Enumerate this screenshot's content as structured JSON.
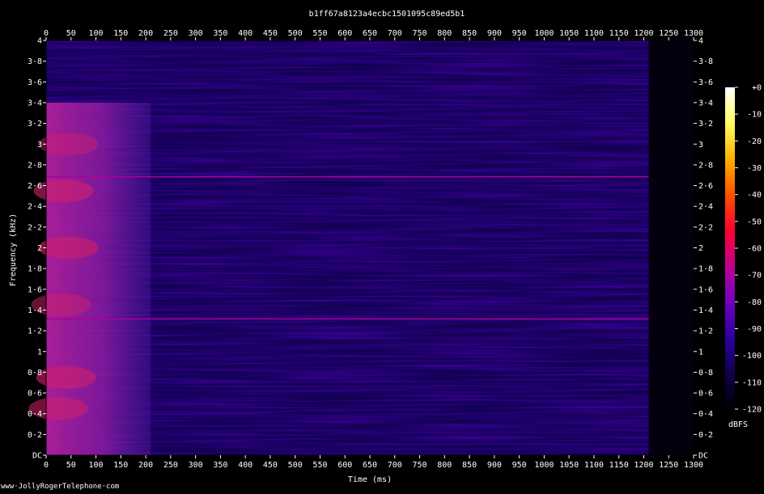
{
  "chart_data": {
    "type": "heatmap",
    "title": "b1ff67a8123a4ecbc1501095c89ed5b1",
    "xlabel": "Time (ms)",
    "ylabel": "Frequency (kHz)",
    "xlim": [
      0,
      1300
    ],
    "ylim": [
      0,
      4
    ],
    "x_ticks": [
      "0",
      "50",
      "100",
      "150",
      "200",
      "250",
      "300",
      "350",
      "400",
      "450",
      "500",
      "550",
      "600",
      "650",
      "700",
      "750",
      "800",
      "850",
      "900",
      "950",
      "1000",
      "1050",
      "1100",
      "1150",
      "1200",
      "1250",
      "1300"
    ],
    "y_ticks": [
      {
        "value": 4,
        "label": "4"
      },
      {
        "value": 3.8,
        "label": "3·8"
      },
      {
        "value": 3.6,
        "label": "3·6"
      },
      {
        "value": 3.4,
        "label": "3·4"
      },
      {
        "value": 3.2,
        "label": "3·2"
      },
      {
        "value": 3,
        "label": "3"
      },
      {
        "value": 2.8,
        "label": "2·8"
      },
      {
        "value": 2.6,
        "label": "2·6"
      },
      {
        "value": 2.4,
        "label": "2·4"
      },
      {
        "value": 2.2,
        "label": "2·2"
      },
      {
        "value": 2,
        "label": "2"
      },
      {
        "value": 1.8,
        "label": "1·8"
      },
      {
        "value": 1.6,
        "label": "1·6"
      },
      {
        "value": 1.4,
        "label": "1·4"
      },
      {
        "value": 1.2,
        "label": "1·2"
      },
      {
        "value": 1,
        "label": "1"
      },
      {
        "value": 0.8,
        "label": "0·8"
      },
      {
        "value": 0.6,
        "label": "0·6"
      },
      {
        "value": 0.4,
        "label": "0·4"
      },
      {
        "value": 0.2,
        "label": "0·2"
      },
      {
        "value": 0,
        "label": "DC"
      }
    ],
    "colorbar": {
      "label": "dBFS",
      "range": [
        -120,
        0
      ],
      "ticks": [
        "+0",
        "-10",
        "-20",
        "-30",
        "-40",
        "-50",
        "-60",
        "-70",
        "-80",
        "-90",
        "-100",
        "-110",
        "-120"
      ],
      "colors": [
        "#000000",
        "#10004a",
        "#2a00a0",
        "#7000c0",
        "#c00090",
        "#ff0030",
        "#ff5000",
        "#ffb000",
        "#ffff60",
        "#ffffff"
      ]
    },
    "regions": [
      {
        "name": "onset burst",
        "t_start": 0,
        "t_end": 210,
        "f_start": 0,
        "f_end": 3.4,
        "level_db": -55
      },
      {
        "name": "background",
        "t_start": 210,
        "t_end": 1210,
        "f_start": 0,
        "f_end": 4,
        "level_db": -105
      },
      {
        "name": "tone line",
        "t_start": 0,
        "t_end": 1210,
        "f_start": 2.68,
        "f_end": 2.69,
        "level_db": -70
      },
      {
        "name": "tone line",
        "t_start": 0,
        "t_end": 1210,
        "f_start": 1.31,
        "f_end": 1.32,
        "level_db": -70
      },
      {
        "name": "silence",
        "t_start": 1210,
        "t_end": 1300,
        "f_start": 0,
        "f_end": 4,
        "level_db": -118
      }
    ]
  },
  "footer": "www·JollyRogerTelephone·com"
}
